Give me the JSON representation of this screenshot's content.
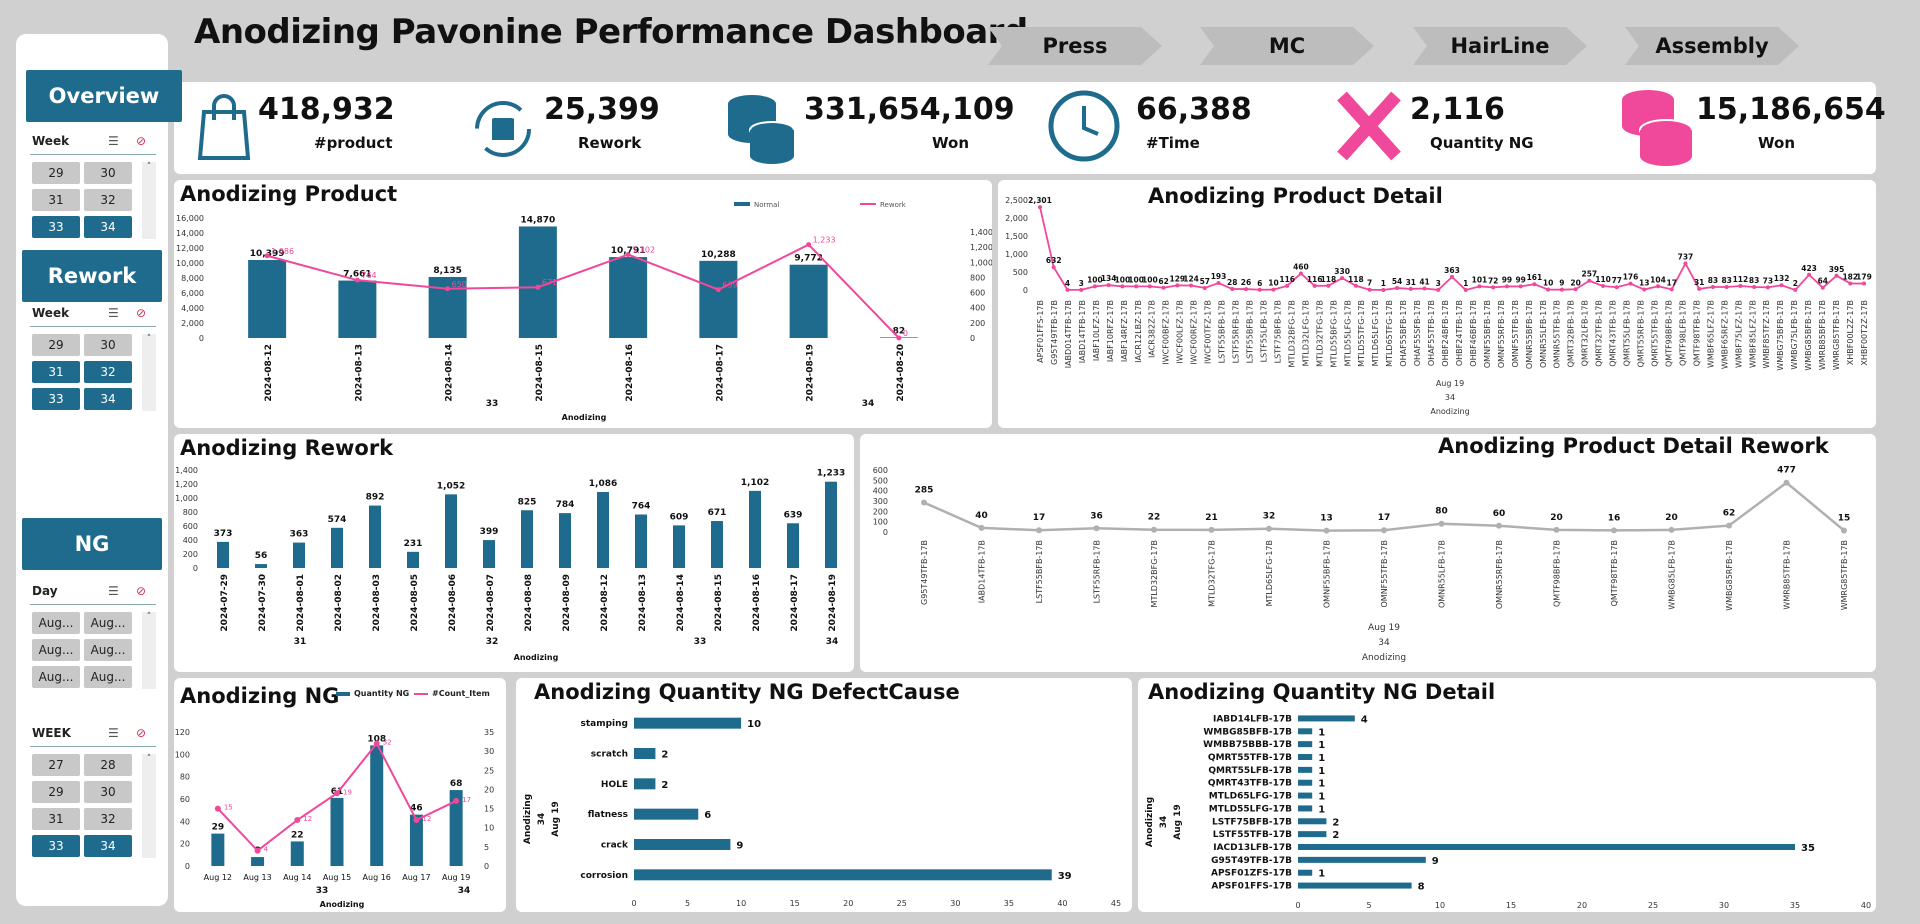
{
  "dashboard_title": "Anodizing Pavonine Performance Dashboard",
  "nav": [
    "Press",
    "MC",
    "HairLine",
    "Assembly"
  ],
  "colors": {
    "primary": "#1f6b8e",
    "accent": "#f0489a",
    "grey": "#b0b0b0"
  },
  "sidebar": {
    "overview": {
      "header": "Overview",
      "label": "Week",
      "items": [
        {
          "t": "29",
          "on": false
        },
        {
          "t": "30",
          "on": false
        },
        {
          "t": "31",
          "on": false
        },
        {
          "t": "32",
          "on": false
        },
        {
          "t": "33",
          "on": true
        },
        {
          "t": "34",
          "on": true
        }
      ]
    },
    "rework": {
      "header": "Rework",
      "label": "Week",
      "items": [
        {
          "t": "29",
          "on": false
        },
        {
          "t": "30",
          "on": false
        },
        {
          "t": "31",
          "on": true
        },
        {
          "t": "32",
          "on": true
        },
        {
          "t": "33",
          "on": true
        },
        {
          "t": "34",
          "on": true
        }
      ]
    },
    "ng": {
      "header": "NG",
      "label": "Day",
      "items": [
        {
          "t": "Aug...",
          "on": false
        },
        {
          "t": "Aug...",
          "on": false
        },
        {
          "t": "Aug...",
          "on": false
        },
        {
          "t": "Aug...",
          "on": false
        },
        {
          "t": "Aug...",
          "on": false
        },
        {
          "t": "Aug...",
          "on": false
        }
      ]
    },
    "week": {
      "label": "WEEK",
      "items": [
        {
          "t": "27",
          "on": false
        },
        {
          "t": "28",
          "on": false
        },
        {
          "t": "29",
          "on": false
        },
        {
          "t": "30",
          "on": false
        },
        {
          "t": "31",
          "on": false
        },
        {
          "t": "32",
          "on": false
        },
        {
          "t": "33",
          "on": true
        },
        {
          "t": "34",
          "on": true
        }
      ]
    }
  },
  "kpis": [
    {
      "value": "418,932",
      "label": "#product",
      "icon": "shopping-bag-icon"
    },
    {
      "value": "25,399",
      "label": "Rework",
      "icon": "recycle-box-icon"
    },
    {
      "value": "331,654,109",
      "label": "Won",
      "icon": "coins-icon"
    },
    {
      "value": "66,388",
      "label": "#Time",
      "icon": "clock-icon"
    },
    {
      "value": "2,116",
      "label": "Quantity NG",
      "icon": "x-mark-icon"
    },
    {
      "value": "15,186,654",
      "label": "Won",
      "icon": "coins-pink-icon"
    }
  ],
  "chart_titles": {
    "product": "Anodizing Product",
    "product_detail": "Anodizing Product Detail",
    "rework": "Anodizing Rework",
    "rework_detail": "Anodizing Product Detail Rework",
    "ng": "Anodizing NG",
    "ng_cause": "Anodizing Quantity NG DefectCause",
    "ng_detail": "Anodizing Quantity NG Detail"
  },
  "chart_data": [
    {
      "id": "product",
      "type": "bar",
      "categories": [
        "2024-08-12",
        "2024-08-13",
        "2024-08-14",
        "2024-08-15",
        "2024-08-16",
        "2024-08-17",
        "2024-08-19",
        "2024-08-20"
      ],
      "series": [
        {
          "name": "Normal",
          "values": [
            10399,
            7661,
            8135,
            14870,
            10791,
            10288,
            9772,
            82
          ]
        },
        {
          "name": "Rework",
          "values": [
            1086,
            764,
            650,
            671,
            1102,
            639,
            1233,
            0
          ]
        }
      ],
      "bar_labels": [
        "10,399",
        "7,661",
        "8,135",
        "14,870",
        "10,791",
        "10,288",
        "9,772",
        "82"
      ],
      "line_labels": [
        "1,086",
        "764",
        "650",
        "671",
        "1,102",
        "639",
        "1,233",
        "0"
      ],
      "ylim": [
        0,
        16000
      ],
      "y2lim": [
        0,
        1400
      ],
      "yticks": [
        "0",
        "2,000",
        "4,000",
        "6,000",
        "8,000",
        "10,000",
        "12,000",
        "14,000",
        "16,000"
      ],
      "y2ticks": [
        "0",
        "200",
        "400",
        "600",
        "800",
        "1,000",
        "1,200",
        "1,400"
      ],
      "groups": [
        "33",
        "34"
      ],
      "xlabel": "Anodizing"
    },
    {
      "id": "product_detail",
      "type": "line",
      "categories": [
        "APSF01FFS-17B",
        "G95T49TFB-17B",
        "IABD014TFB-17B",
        "IABD14TFB-17B",
        "IABF10LFZ-17B",
        "IABF10RFZ-17B",
        "IABF14RFZ-17B",
        "IACR12LBZ-17B",
        "IACR382Z-17B",
        "IWCF00BFZ-17B",
        "IWCF00LFZ-17B",
        "IWCF00RFZ-17B",
        "IWCF00TFZ-17B",
        "LSTF55BFB-17B",
        "LSTF55RFB-17B",
        "LSTF55BFB-17B",
        "LSTF55LFB-17B",
        "LSTF75BFB-17B",
        "MTLD32BFG-17B",
        "MTLD32LFG-17B",
        "MTLD32TFG-17B",
        "MTLD55BFG-17B",
        "MTLD55LFG-17B",
        "MTLD55TFG-17B",
        "MTLD65LFG-17B",
        "MTLD65TFG-17B",
        "OHAF55BFB-17B",
        "OHAF55SFB-17B",
        "OHAF55TFB-17B",
        "OHBF24BFB-17B",
        "OHBF24TFB-17B",
        "OHBF46BFB-17B",
        "OMNF55BFB-17B",
        "OMNF55RFB-17B",
        "OMNF55TFB-17B",
        "OMNR55BFB-17B",
        "OMNR55LFB-17B",
        "OMNR55TFB-17B",
        "QMRT32BFB-17B",
        "QMRT32LFB-17B",
        "QMRT32TFB-17B",
        "QMRT43TFB-17B",
        "QMRT55LFB-17B",
        "QMRT55RFB-17B",
        "QMRT55TFB-17B",
        "QMTF98BFB-17B",
        "QMTF98LFB-17B",
        "QMTF98TFB-17B",
        "WMBF65LFZ-17B",
        "WMBF65RFZ-17B",
        "WMBF75LFZ-17B",
        "WMBF85LFZ-17B",
        "WMBF85TFZ-17B",
        "WMBG75BFB-17B",
        "WMBG75LFB-17B",
        "WMBG85BFB-17B",
        "WMRB85BFB-17B",
        "WMRG85TFB-17B",
        "XHBF00L2Z-17B",
        "XHBF00T2Z-17B"
      ],
      "values": [
        2301,
        632,
        4,
        3,
        100,
        134,
        100,
        100,
        100,
        62,
        129,
        124,
        57,
        193,
        28,
        26,
        6,
        10,
        116,
        460,
        116,
        118,
        330,
        118,
        7,
        1,
        54,
        31,
        41,
        3,
        363,
        1,
        101,
        72,
        99,
        99,
        161,
        10,
        9,
        20,
        257,
        110,
        77,
        176,
        13,
        104,
        17,
        737,
        31,
        83,
        83,
        112,
        83,
        73,
        132,
        2,
        423,
        64,
        395,
        182,
        179
      ],
      "labels_visible": [
        "2,301",
        "632",
        "4",
        "3",
        "100",
        "134",
        "100",
        "100",
        "100",
        "62",
        "129",
        "124",
        "57",
        "193",
        "28",
        "26",
        "6",
        "10",
        "116",
        "460",
        "116",
        "118",
        "330",
        "118",
        "7",
        "1",
        "54",
        "31",
        "41",
        "3",
        "363",
        "1",
        "101",
        "72",
        "99",
        "99",
        "161",
        "10",
        "9",
        "20",
        "257",
        "110",
        "77",
        "176",
        "13",
        "104",
        "17",
        "737",
        "31",
        "83",
        "83",
        "112",
        "83",
        "73",
        "132",
        "2",
        "423",
        "64",
        "395",
        "182",
        "179"
      ],
      "yticks": [
        "0",
        "500",
        "1,000",
        "1,500",
        "2,000",
        "2,500"
      ],
      "ylim": [
        0,
        2500
      ],
      "axis_groups": [
        "Aug 19",
        "34",
        "Anodizing"
      ]
    },
    {
      "id": "rework",
      "type": "bar",
      "categories": [
        "2024-07-29",
        "2024-07-30",
        "2024-08-01",
        "2024-08-02",
        "2024-08-03",
        "2024-08-05",
        "2024-08-06",
        "2024-08-07",
        "2024-08-08",
        "2024-08-09",
        "2024-08-12",
        "2024-08-13",
        "2024-08-14",
        "2024-08-15",
        "2024-08-16",
        "2024-08-17",
        "2024-08-19"
      ],
      "values": [
        373,
        56,
        363,
        574,
        892,
        231,
        1052,
        399,
        825,
        784,
        1086,
        764,
        609,
        671,
        1102,
        639,
        1233
      ],
      "labels": [
        "373",
        "56",
        "363",
        "574",
        "892",
        "231",
        "1,052",
        "399",
        "825",
        "784",
        "1,086",
        "764",
        "609",
        "671",
        "1,102",
        "639",
        "1,233"
      ],
      "yticks": [
        "0",
        "200",
        "400",
        "600",
        "800",
        "1,000",
        "1,200",
        "1,400"
      ],
      "ylim": [
        0,
        1400
      ],
      "groups": [
        "31",
        "32",
        "33",
        "34"
      ],
      "xlabel": "Anodizing"
    },
    {
      "id": "rework_detail",
      "type": "line",
      "categories": [
        "G95T49TFB-17B",
        "IABD14TFB-17B",
        "LSTF55BFB-17B",
        "LSTF55RFB-17B",
        "MTLD32BFG-17B",
        "MTLD32TFG-17B",
        "MTLD65LFG-17B",
        "OMNF55BFB-17B",
        "OMNF55TFB-17B",
        "OMNR55LFB-17B",
        "OMNR55RFB-17B",
        "QMTF98BFB-17B",
        "QMTF98TFB-17B",
        "WMBG85LFB-17B",
        "WMBG85RFB-17B",
        "WMRB85TFB-17B",
        "WMRG85TFB-17B"
      ],
      "values": [
        285,
        40,
        17,
        36,
        22,
        21,
        32,
        13,
        17,
        80,
        60,
        20,
        16,
        20,
        62,
        477,
        15
      ],
      "labels": [
        "285",
        "40",
        "17",
        "36",
        "22",
        "21",
        "32",
        "13",
        "17",
        "80",
        "60",
        "20",
        "16",
        "20",
        "62",
        "477",
        "15"
      ],
      "yticks": [
        "0",
        "100",
        "200",
        "300",
        "400",
        "500",
        "600"
      ],
      "ylim": [
        0,
        600
      ],
      "axis_groups": [
        "Aug 19",
        "34",
        "Anodizing"
      ]
    },
    {
      "id": "ng",
      "type": "bar",
      "categories": [
        "Aug 12",
        "Aug 13",
        "Aug 14",
        "Aug 15",
        "Aug 16",
        "Aug 17",
        "Aug 19"
      ],
      "series": [
        {
          "name": "Quantity NG",
          "values": [
            29,
            8,
            22,
            61,
            108,
            46,
            68
          ]
        },
        {
          "name": "#Count_Item",
          "values": [
            15,
            4,
            12,
            19,
            32,
            12,
            17
          ]
        }
      ],
      "bar_labels": [
        "29",
        "8",
        "22",
        "61",
        "108",
        "46",
        "68"
      ],
      "line_labels": [
        "15",
        "4",
        "12",
        "19",
        "32",
        "12",
        "17"
      ],
      "yticks": [
        "0",
        "20",
        "40",
        "60",
        "80",
        "100",
        "120"
      ],
      "y2ticks": [
        "0",
        "5",
        "10",
        "15",
        "20",
        "25",
        "30",
        "35"
      ],
      "ylim": [
        0,
        120
      ],
      "y2lim": [
        0,
        35
      ],
      "groups": [
        "33",
        "34"
      ],
      "xlabel": "Anodizing"
    },
    {
      "id": "ng_cause",
      "type": "bar",
      "orientation": "horizontal",
      "categories": [
        "stamping",
        "scratch",
        "HOLE",
        "flatness",
        "crack",
        "corrosion"
      ],
      "values": [
        10,
        2,
        2,
        6,
        9,
        39
      ],
      "labels": [
        "10",
        "2",
        "2",
        "6",
        "9",
        "39"
      ],
      "xticks": [
        "0",
        "5",
        "10",
        "15",
        "20",
        "25",
        "30",
        "35",
        "40",
        "45"
      ],
      "xlim": [
        0,
        45
      ],
      "axis_groups": [
        "Anodizing",
        "34",
        "Aug 19"
      ]
    },
    {
      "id": "ng_detail",
      "type": "bar",
      "orientation": "horizontal",
      "categories": [
        "IABD14LFB-17B",
        "WMBG85BFB-17B",
        "WMBB75BBB-17B",
        "QMRT55TFB-17B",
        "QMRT55LFB-17B",
        "QMRT43TFB-17B",
        "MTLD65LFG-17B",
        "MTLD55LFG-17B",
        "LSTF75BFB-17B",
        "LSTF55TFB-17B",
        "IACD13LFB-17B",
        "G95T49TFB-17B",
        "APSF01ZFS-17B",
        "APSF01FFS-17B"
      ],
      "values": [
        4,
        1,
        1,
        1,
        1,
        1,
        1,
        1,
        2,
        2,
        35,
        9,
        1,
        8
      ],
      "labels": [
        "4",
        "1",
        "1",
        "1",
        "1",
        "1",
        "1",
        "1",
        "2",
        "2",
        "35",
        "9",
        "1",
        "8"
      ],
      "xticks": [
        "0",
        "5",
        "10",
        "15",
        "20",
        "25",
        "30",
        "35",
        "40"
      ],
      "xlim": [
        0,
        40
      ],
      "axis_groups": [
        "Anodizing",
        "34",
        "Aug 19"
      ]
    }
  ]
}
